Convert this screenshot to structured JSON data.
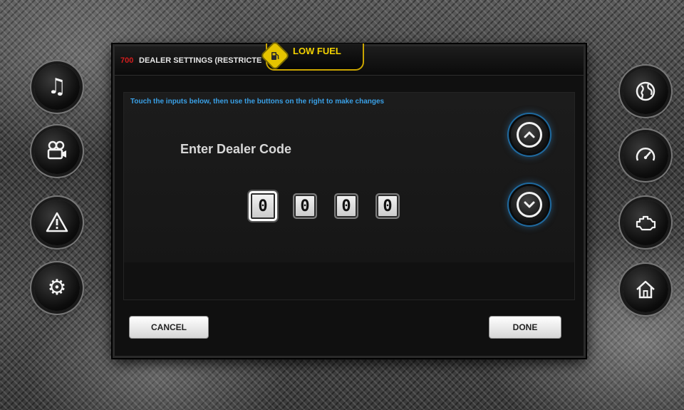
{
  "title": {
    "code": "700",
    "text": "DEALER SETTINGS (RESTRICTE"
  },
  "alert": {
    "label": "LOW FUEL",
    "color": "#f3d200",
    "icon": "fuel-pump-icon"
  },
  "instructions": "Touch the inputs below, then use the buttons on the right to make changes",
  "code_entry": {
    "label": "Enter Dealer Code",
    "digits": [
      "0",
      "0",
      "0",
      "0"
    ],
    "selected_index": 0
  },
  "buttons": {
    "cancel": "CANCEL",
    "done": "DONE",
    "increment_icon": "chevron-up-icon",
    "decrement_icon": "chevron-down-icon"
  },
  "side_nav": {
    "left": [
      {
        "icon": "music-note-icon"
      },
      {
        "icon": "camera-icon"
      },
      {
        "icon": "warning-icon"
      },
      {
        "icon": "gear-icon"
      }
    ],
    "right": [
      {
        "icon": "globe-icon"
      },
      {
        "icon": "speedometer-icon"
      },
      {
        "icon": "engine-icon"
      },
      {
        "icon": "home-icon"
      }
    ]
  },
  "colors": {
    "accent_blue": "#3aa0e6",
    "title_number_red": "#d21d1d",
    "alert_yellow": "#f3d200"
  }
}
